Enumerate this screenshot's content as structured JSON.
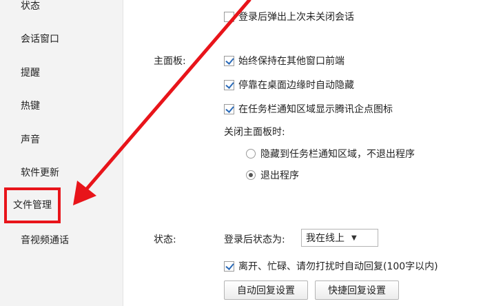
{
  "sidebar": {
    "items": [
      {
        "label": "状态"
      },
      {
        "label": "会话窗口"
      },
      {
        "label": "提醒"
      },
      {
        "label": "热键"
      },
      {
        "label": "声音"
      },
      {
        "label": "软件更新"
      },
      {
        "label": "文件管理"
      },
      {
        "label": "音视频通话"
      }
    ]
  },
  "login": {
    "restore_sessions": {
      "label": "登录后弹出上次未关闭会话",
      "checked": false
    }
  },
  "main_panel": {
    "section_label": "主面板:",
    "options": [
      {
        "label": "始终保持在其他窗口前端",
        "checked": true
      },
      {
        "label": "停靠在桌面边缘时自动隐藏",
        "checked": true
      },
      {
        "label": "在任务栏通知区域显示腾讯企点图标",
        "checked": true
      }
    ],
    "close_label": "关闭主面板时:",
    "close_options": [
      {
        "label": "隐藏到任务栏通知区域，不退出程序",
        "selected": false
      },
      {
        "label": "退出程序",
        "selected": true
      }
    ]
  },
  "status": {
    "section_label": "状态:",
    "login_status_label": "登录后状态为:",
    "login_status_value": "我在线上",
    "auto_reply": {
      "label": "离开、忙碌、请勿打扰时自动回复(100字以内)",
      "checked": true
    },
    "auto_reply_settings_button": "自动回复设置",
    "quick_reply_settings_button": "快捷回复设置"
  },
  "colors": {
    "highlight": "#e8141a",
    "arrow": "#e8141a",
    "checkmark": "#2a6ab8"
  }
}
